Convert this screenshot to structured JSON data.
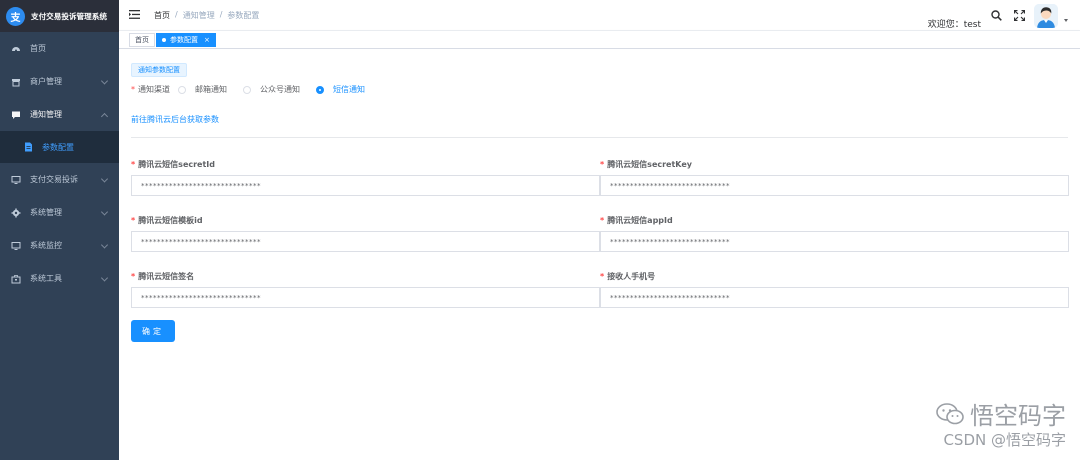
{
  "app": {
    "title": "支付交易投诉管理系统",
    "logo_glyph": "支"
  },
  "sidebar": {
    "items": [
      {
        "label": "首页",
        "icon": "dashboard-icon"
      },
      {
        "label": "商户管理",
        "icon": "shop-icon"
      },
      {
        "label": "通知管理",
        "icon": "message-icon"
      },
      {
        "label": "支付交易投诉",
        "icon": "monitor-icon"
      },
      {
        "label": "系统管理",
        "icon": "gear-icon"
      },
      {
        "label": "系统监控",
        "icon": "monitor-icon"
      },
      {
        "label": "系统工具",
        "icon": "toolbox-icon"
      }
    ],
    "submenu": {
      "label": "参数配置",
      "icon": "document-icon"
    }
  },
  "header": {
    "breadcrumb": [
      "首页",
      "通知管理",
      "参数配置"
    ],
    "separator": "/",
    "welcome": "欢迎您：test"
  },
  "tags": [
    {
      "label": "首页"
    },
    {
      "label": "参数配置",
      "close": "×"
    }
  ],
  "form": {
    "section_tag": "通知参数配置",
    "channel_label": "通知渠道",
    "channels": [
      "邮箱通知",
      "公众号通知",
      "短信通知"
    ],
    "selected_channel": "短信通知",
    "link_text": "前往腾讯云后台获取参数",
    "required_mark": "*",
    "fields": [
      {
        "label": "腾讯云短信secretId",
        "value": "******************************"
      },
      {
        "label": "腾讯云短信secretKey",
        "value": "******************************"
      },
      {
        "label": "腾讯云短信模板id",
        "value": "******************************"
      },
      {
        "label": "腾讯云短信appId",
        "value": "******************************"
      },
      {
        "label": "腾讯云短信签名",
        "value": "******************************"
      },
      {
        "label": "接收人手机号",
        "value": "******************************"
      }
    ],
    "confirm_label": "确定"
  },
  "watermark": {
    "line1": "悟空码字",
    "line2": "CSDN @悟空码字"
  },
  "colors": {
    "primary": "#1890ff",
    "sidebar": "#304156",
    "sidebar_active": "#409eff"
  }
}
